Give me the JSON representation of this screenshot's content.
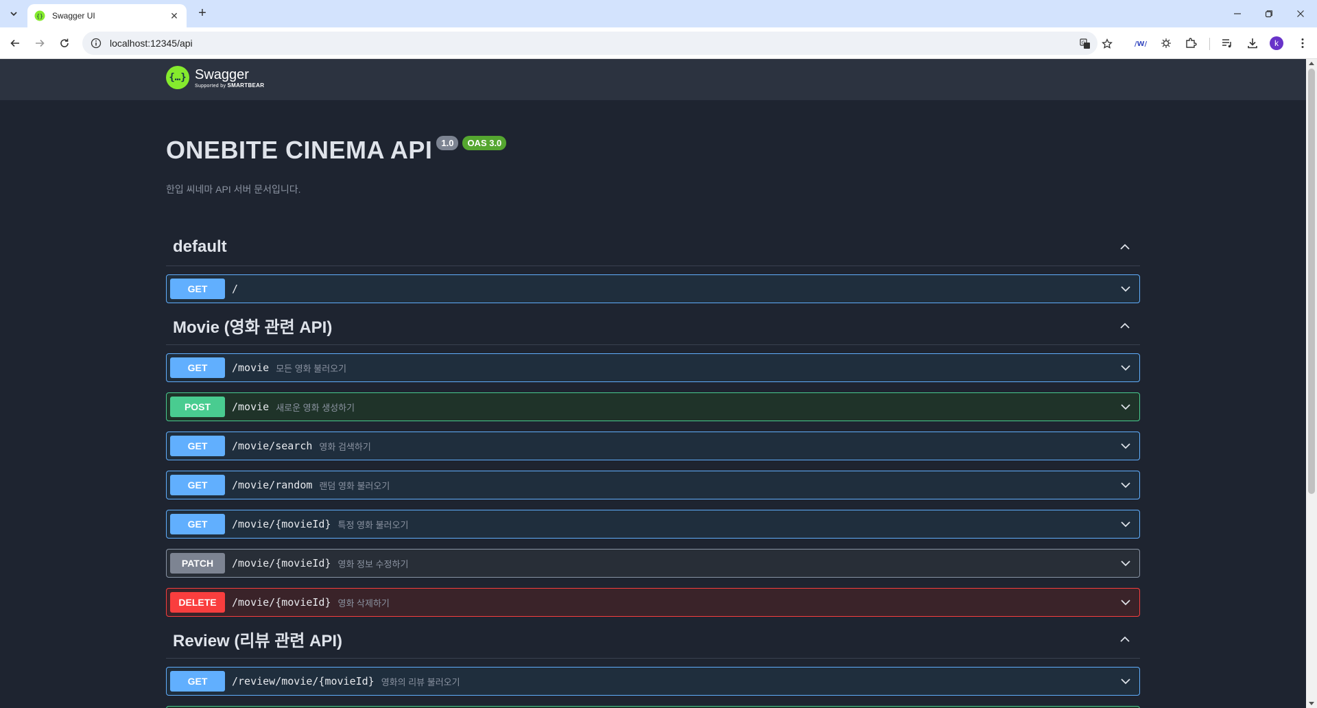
{
  "browser": {
    "tab_title": "Swagger UI",
    "tab_close": "✕",
    "new_tab": "+",
    "url": "localhost:12345/api",
    "profile_initial": "k"
  },
  "swagger": {
    "logo_name": "Swagger",
    "logo_sub_prefix": "Supported by",
    "logo_sub_brand": "SMARTBEAR",
    "title": "ONEBITE CINEMA API",
    "version": "1.0",
    "oas": "OAS 3.0",
    "description": "한입 씨네마 API 서버 문서입니다."
  },
  "sections": [
    {
      "title": "default",
      "operations": [
        {
          "method": "GET",
          "path": "/",
          "summary": ""
        }
      ]
    },
    {
      "title": "Movie (영화 관련 API)",
      "operations": [
        {
          "method": "GET",
          "path": "/movie",
          "summary": "모든 영화 불러오기"
        },
        {
          "method": "POST",
          "path": "/movie",
          "summary": "새로운 영화 생성하기"
        },
        {
          "method": "GET",
          "path": "/movie/search",
          "summary": "영화 검색하기"
        },
        {
          "method": "GET",
          "path": "/movie/random",
          "summary": "랜덤 영화 불러오기"
        },
        {
          "method": "GET",
          "path": "/movie/{movieId}",
          "summary": "특정 영화 불러오기"
        },
        {
          "method": "PATCH",
          "path": "/movie/{movieId}",
          "summary": "영화 정보 수정하기"
        },
        {
          "method": "DELETE",
          "path": "/movie/{movieId}",
          "summary": "영화 삭제하기"
        }
      ]
    },
    {
      "title": "Review (리뷰 관련 API)",
      "operations": [
        {
          "method": "GET",
          "path": "/review/movie/{movieId}",
          "summary": "영화의 리뷰 불러오기"
        }
      ]
    }
  ],
  "colors": {
    "get": "#61affe",
    "post": "#49cc90",
    "patch": "#7d8492",
    "delete": "#f93e3e",
    "logo": "#85ea2d"
  }
}
